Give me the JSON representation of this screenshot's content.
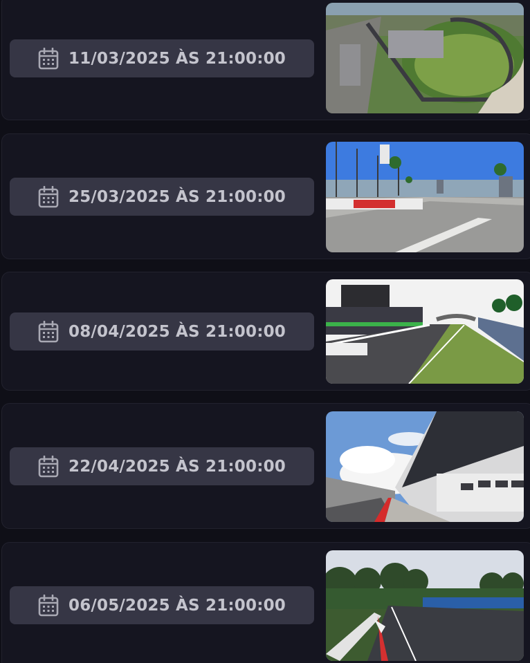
{
  "events": [
    {
      "date_label": "11/03/2025 ÀS 21:00:00",
      "thumbnail": "track-aerial-oval"
    },
    {
      "date_label": "25/03/2025 ÀS 21:00:00",
      "thumbnail": "track-street-palms"
    },
    {
      "date_label": "08/04/2025 ÀS 21:00:00",
      "thumbnail": "track-pit-straight"
    },
    {
      "date_label": "22/04/2025 ÀS 21:00:00",
      "thumbnail": "track-pit-building"
    },
    {
      "date_label": "06/05/2025 ÀS 21:00:00",
      "thumbnail": "track-forest-corner"
    }
  ]
}
